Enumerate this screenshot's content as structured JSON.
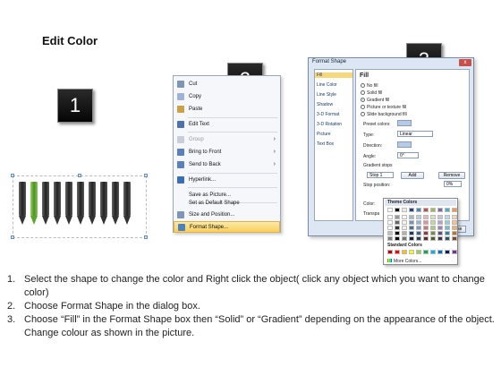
{
  "title": "Edit Color",
  "badges": [
    "1",
    "2",
    "3"
  ],
  "context_menu": {
    "items": [
      {
        "label": "Cut",
        "icon": "scissors-icon",
        "disabled": false,
        "submenu": false,
        "active": false
      },
      {
        "label": "Copy",
        "icon": "copy-icon",
        "disabled": false,
        "submenu": false,
        "active": false
      },
      {
        "label": "Paste",
        "icon": "paste-icon",
        "disabled": false,
        "submenu": false,
        "active": false
      },
      {
        "label": "Edit Text",
        "icon": "edit-text-icon",
        "disabled": false,
        "submenu": false,
        "active": false
      },
      {
        "label": "Group",
        "icon": "group-icon",
        "disabled": true,
        "submenu": true,
        "active": false
      },
      {
        "label": "Bring to Front",
        "icon": "bring-front-icon",
        "disabled": false,
        "submenu": true,
        "active": false
      },
      {
        "label": "Send to Back",
        "icon": "send-back-icon",
        "disabled": false,
        "submenu": true,
        "active": false
      },
      {
        "label": "Hyperlink...",
        "icon": "hyperlink-icon",
        "disabled": false,
        "submenu": false,
        "active": false
      },
      {
        "label": "Save as Picture...",
        "icon": "",
        "disabled": false,
        "submenu": false,
        "active": false
      },
      {
        "label": "Set as Default Shape",
        "icon": "",
        "disabled": false,
        "submenu": false,
        "active": false
      },
      {
        "label": "Size and Position...",
        "icon": "size-position-icon",
        "disabled": false,
        "submenu": false,
        "active": false
      },
      {
        "label": "Format Shape...",
        "icon": "format-shape-icon",
        "disabled": false,
        "submenu": false,
        "active": true
      }
    ],
    "arrow": "›"
  },
  "dialog": {
    "title": "Format Shape",
    "close": "x",
    "nav": [
      "Fill",
      "Line Color",
      "Line Style",
      "Shadow",
      "3-D Format",
      "3-D Rotation",
      "Picture",
      "Text Box"
    ],
    "panel": {
      "heading": "Fill",
      "options": [
        "No fill",
        "Solid fill",
        "Gradient fill",
        "Picture or texture fill",
        "Slide background fill"
      ],
      "selected_option": "Gradient fill",
      "preset_label": "Preset colors:",
      "type_label": "Type:",
      "type_value": "Linear",
      "direction_label": "Direction:",
      "angle_label": "Angle:",
      "angle_value": "0°",
      "stops_label": "Gradient stops",
      "stop_value": "Stop 1",
      "add_label": "Add",
      "remove_label": "Remove",
      "stop_position_label": "Stop position:",
      "stop_position_value": "0%",
      "color_label": "Color:",
      "transparency_label": "Transpa",
      "rotate_label": "Rotate",
      "close_button": "Close"
    }
  },
  "picker": {
    "theme_label": "Theme Colors",
    "standard_label": "Standard Colors",
    "more_label": "More Colors...",
    "top_row": [
      "#ffffff",
      "#000000",
      "#eeece1",
      "#1f497d",
      "#4f81bd",
      "#c0504d",
      "#9bbb59",
      "#8064a2",
      "#4bacc6",
      "#f79646"
    ],
    "standard_row": [
      "#c00000",
      "#ff0000",
      "#ffc000",
      "#ffff00",
      "#92d050",
      "#00b050",
      "#00b0f0",
      "#0070c0",
      "#002060",
      "#7030a0"
    ]
  },
  "steps": [
    {
      "num": "1.",
      "text": "Select the shape to change the color and Right click the object( click any object which you want to change color)"
    },
    {
      "num": "2.",
      "text": "Choose Format Shape in the dialog box."
    },
    {
      "num": "3.",
      "text": "Choose “Fill” in the Format Shape box then “Solid” or “Gradient” depending on the appearance of the object. Change colour as shown in the picture."
    }
  ],
  "colors": {
    "pencil_body": "#2b2b2b",
    "pencil_highlight": "#5aa62a",
    "menu_active": "#f8cf5f",
    "dialog_bg": "#dde7f3"
  }
}
